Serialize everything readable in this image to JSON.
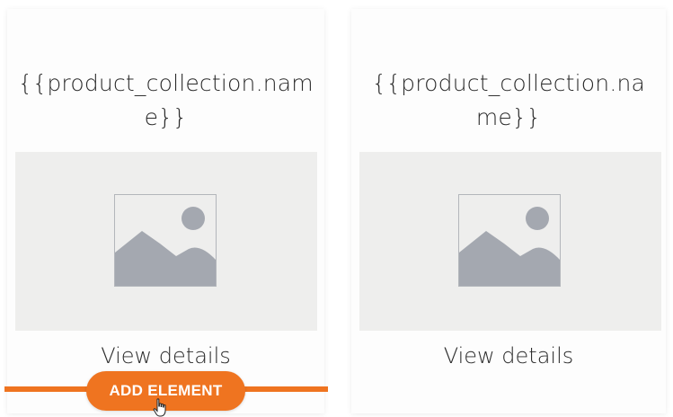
{
  "cards": [
    {
      "title": "{{product_collection.name}}",
      "image_icon": "image-placeholder-icon",
      "link_label": "View details"
    },
    {
      "title": "{{product_collection.name}}",
      "image_icon": "image-placeholder-icon",
      "link_label": "View details"
    }
  ],
  "add_element": {
    "label": "ADD ELEMENT"
  },
  "colors": {
    "accent": "#ef7420",
    "image_bg": "#eeeeed",
    "placeholder_gray": "#a4a8b0",
    "text": "#2b2b2b"
  }
}
